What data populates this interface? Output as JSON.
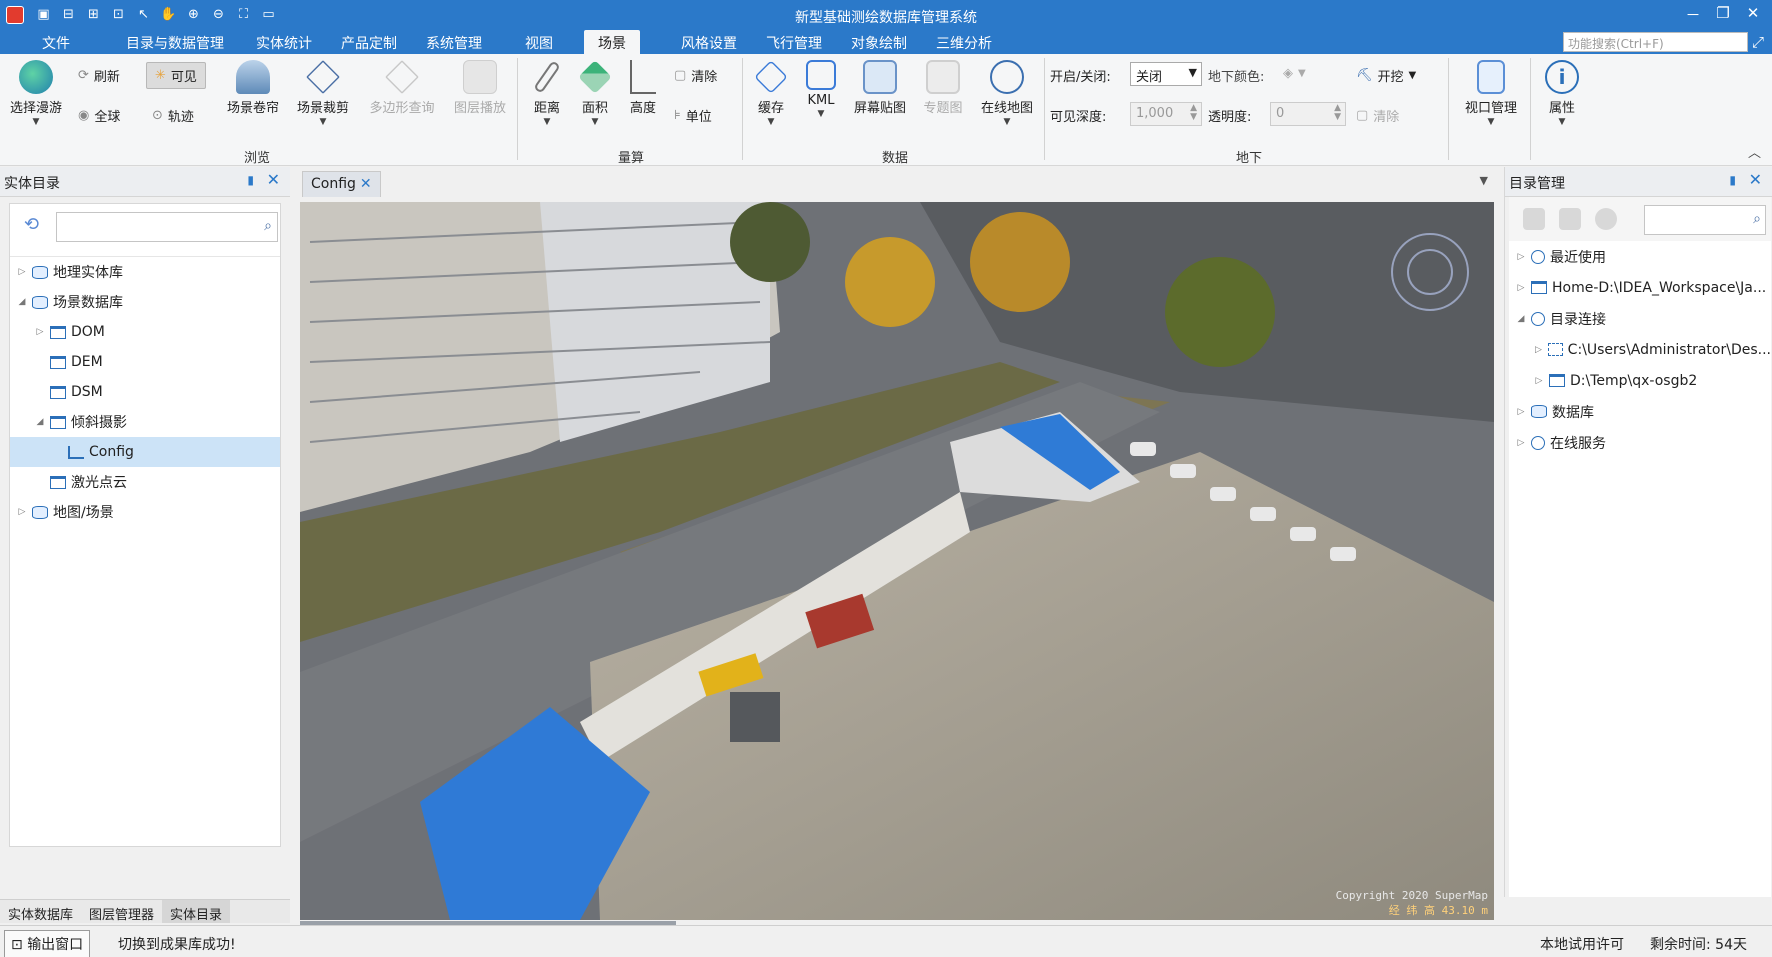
{
  "window": {
    "title": "新型基础测绘数据库管理系统",
    "quick_access": [
      "save-icon",
      "save-as-icon",
      "new-icon",
      "open-icon",
      "pointer-icon",
      "pan-icon",
      "zoom-in-icon",
      "zoom-out-icon",
      "full-extent-icon",
      "folder-icon"
    ],
    "controls": [
      "－",
      "❐",
      "✕"
    ]
  },
  "menu": {
    "tabs": [
      "文件",
      "目录与数据管理",
      "实体统计",
      "产品定制",
      "系统管理",
      "视图",
      "场景",
      "风格设置",
      "飞行管理",
      "对象绘制",
      "三维分析"
    ],
    "active_tab": "场景",
    "search_placeholder": "功能搜索(Ctrl+F)"
  },
  "ribbon": {
    "browse": {
      "group_label": "浏览",
      "select_roam": "选择漫游",
      "refresh": "刷新",
      "visible": "可见",
      "full_globe": "全球",
      "track": "轨迹",
      "scene_shutter": "场景卷帘",
      "scene_clip": "场景裁剪",
      "polygon_query": "多边形查询",
      "layer_play": "图层播放"
    },
    "measure": {
      "group_label": "量算",
      "distance": "距离",
      "area": "面积",
      "height": "高度",
      "clear": "清除",
      "unit": "单位"
    },
    "data": {
      "group_label": "数据",
      "cache": "缓存",
      "kml": "KML",
      "screen_overlay": "屏幕贴图",
      "thematic": "专题图",
      "online_map": "在线地图"
    },
    "underground": {
      "group_label": "地下",
      "toggle_label": "开启/关闭:",
      "toggle_value": "关闭",
      "color_label": "地下颜色:",
      "excavate": "开挖",
      "depth_label": "可见深度:",
      "depth_value": "1,000",
      "opacity_label": "透明度:",
      "opacity_value": "0",
      "clear": "清除"
    },
    "view": {
      "viewport_mgr": "视口管理",
      "properties": "属性"
    }
  },
  "left_panel": {
    "title": "实体目录",
    "tree": [
      {
        "label": "地理实体库",
        "level": 0,
        "toggle": "▷",
        "icon": "db-icon"
      },
      {
        "label": "场景数据库",
        "level": 0,
        "toggle": "◢",
        "icon": "db-icon"
      },
      {
        "label": "DOM",
        "level": 1,
        "toggle": "▷",
        "icon": "folder-icon"
      },
      {
        "label": "DEM",
        "level": 1,
        "toggle": "",
        "icon": "folder-icon"
      },
      {
        "label": "DSM",
        "level": 1,
        "toggle": "",
        "icon": "folder-icon"
      },
      {
        "label": "倾斜摄影",
        "level": 1,
        "toggle": "◢",
        "icon": "folder-icon"
      },
      {
        "label": "Config",
        "level": 2,
        "toggle": "",
        "icon": "config-icon",
        "selected": true
      },
      {
        "label": "激光点云",
        "level": 1,
        "toggle": "",
        "icon": "folder-icon"
      },
      {
        "label": "地图/场景",
        "level": 0,
        "toggle": "▷",
        "icon": "db-icon"
      }
    ],
    "bottom_tabs": [
      "实体数据库",
      "图层管理器",
      "实体目录"
    ],
    "active_bottom_tab": "实体目录"
  },
  "document": {
    "tab_label": "Config",
    "copyright": "Copyright 2020 SuperMap",
    "coords": "经 纬 高 43.10 m"
  },
  "right_panel": {
    "title": "目录管理",
    "tree": [
      {
        "label": "最近使用",
        "level": 0,
        "toggle": "▷",
        "icon": "clock-icon"
      },
      {
        "label": "Home-D:\\IDEA_Workspace\\Ja...",
        "level": 0,
        "toggle": "▷",
        "icon": "home-icon"
      },
      {
        "label": "目录连接",
        "level": 0,
        "toggle": "◢",
        "icon": "link-icon"
      },
      {
        "label": "C:\\Users\\Administrator\\Des...",
        "level": 1,
        "toggle": "▷",
        "icon": "grid-icon"
      },
      {
        "label": "D:\\Temp\\qx-osgb2",
        "level": 1,
        "toggle": "▷",
        "icon": "folder-icon"
      },
      {
        "label": "数据库",
        "level": 0,
        "toggle": "▷",
        "icon": "db-icon"
      },
      {
        "label": "在线服务",
        "level": 0,
        "toggle": "▷",
        "icon": "globe-icon"
      }
    ]
  },
  "status": {
    "output_window": "输出窗口",
    "message": "切换到成果库成功!",
    "license": "本地试用许可",
    "remaining": "剩余时间: 54天"
  },
  "colors": {
    "brand": "#2b79c9",
    "selection": "#cce3f7"
  }
}
